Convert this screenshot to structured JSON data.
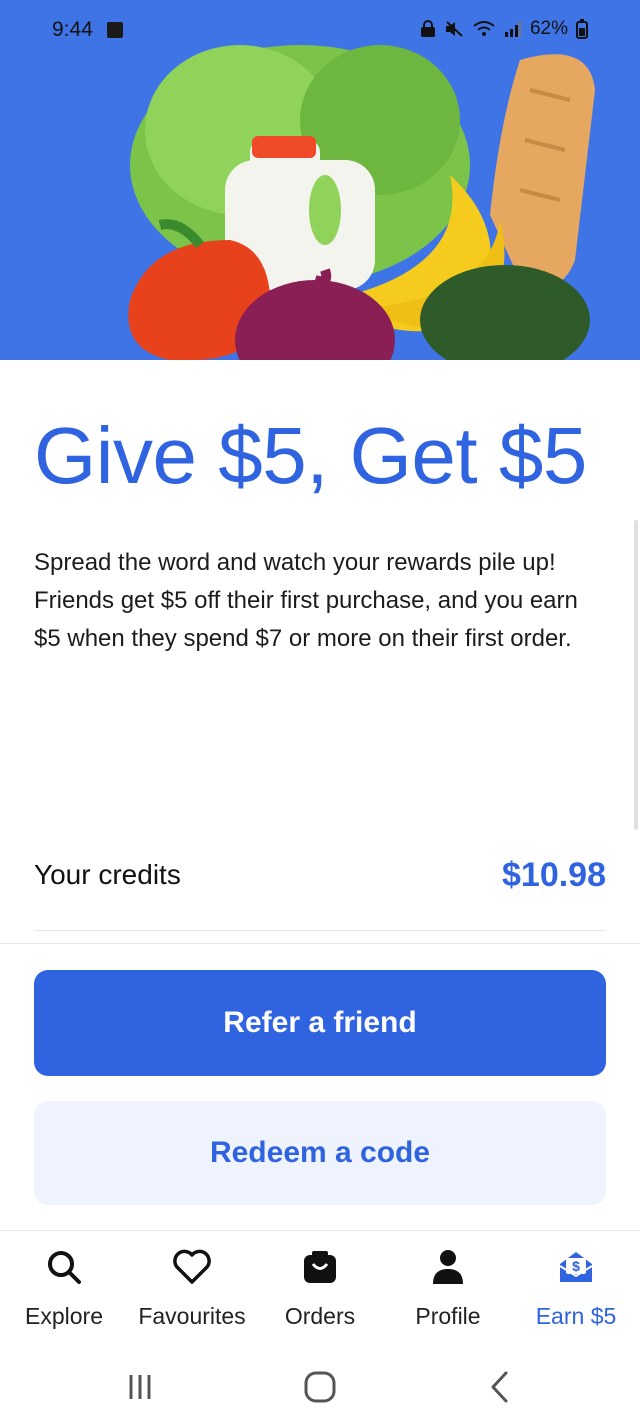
{
  "status_bar": {
    "time": "9:44",
    "battery": "62%"
  },
  "hero": {
    "image_alt": "groceries-illustration"
  },
  "promo": {
    "headline": "Give $5, Get $5",
    "description": "Spread the word and watch your rewards pile up! Friends get $5 off their first purchase, and you earn $5 when they spend $7 or more on their first order."
  },
  "credits": {
    "label": "Your credits",
    "value": "$10.98"
  },
  "actions": {
    "primary_label": "Refer a friend",
    "secondary_label": "Redeem a code"
  },
  "bottom_nav": {
    "items": [
      {
        "label": "Explore",
        "icon": "search-icon"
      },
      {
        "label": "Favourites",
        "icon": "heart-icon"
      },
      {
        "label": "Orders",
        "icon": "bag-icon"
      },
      {
        "label": "Profile",
        "icon": "person-icon"
      },
      {
        "label": "Earn $5",
        "icon": "gift-dollar-icon",
        "active": true
      }
    ]
  },
  "colors": {
    "accent": "#2f63e0",
    "hero_bg": "#3f74e6",
    "secondary_bg": "#eef3fd"
  }
}
